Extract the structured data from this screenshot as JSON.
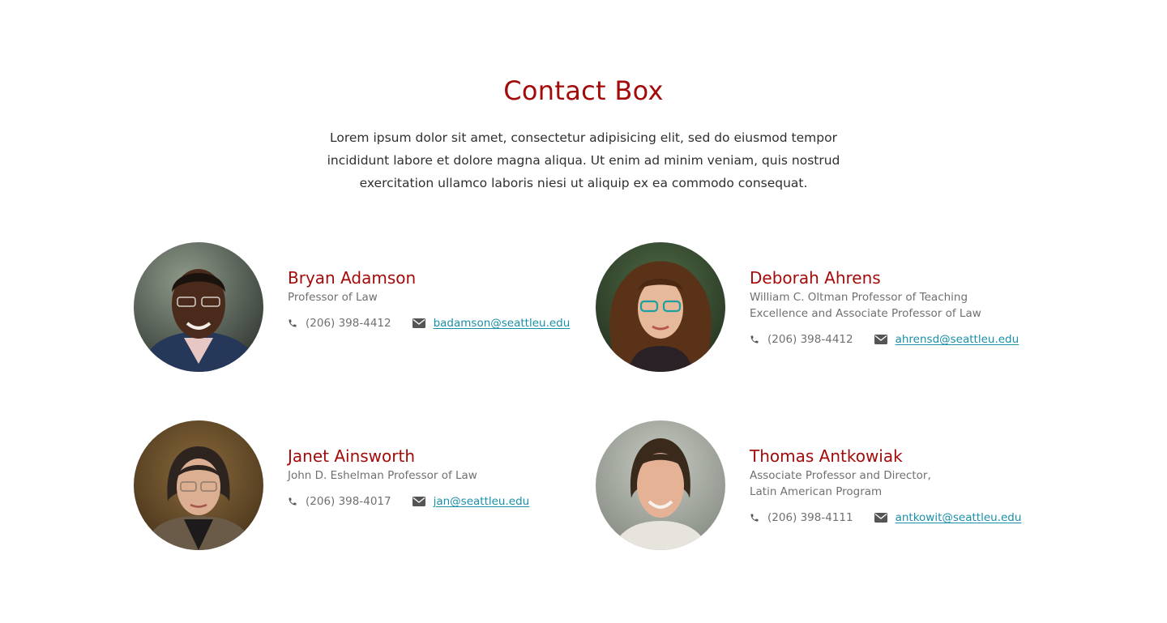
{
  "section": {
    "title": "Contact Box",
    "intro": "Lorem ipsum dolor sit amet, consectetur adipisicing elit, sed do eiusmod tempor incididunt labore et dolore magna aliqua. Ut enim ad minim veniam, quis nostrud exercitation ullamco laboris niesi ut aliquip ex ea commodo consequat."
  },
  "contacts": [
    {
      "name": "Bryan Adamson",
      "title": "Professor of Law",
      "phone": "(206) 398-4412",
      "email": "badamson@seattleu.edu",
      "icons": {
        "phone": "phone-icon",
        "email": "envelope-icon"
      }
    },
    {
      "name": "Deborah Ahrens",
      "title": "William C. Oltman Professor of Teaching Excellence and Associate Professor of Law",
      "phone": "(206) 398-4412",
      "email": "ahrensd@seattleu.edu",
      "icons": {
        "phone": "phone-icon",
        "email": "envelope-icon"
      }
    },
    {
      "name": "Janet Ainsworth",
      "title": "John D. Eshelman Professor of Law",
      "phone": "(206) 398-4017",
      "email": "jan@seattleu.edu",
      "icons": {
        "phone": "phone-icon",
        "email": "envelope-icon"
      }
    },
    {
      "name": "Thomas Antkowiak",
      "title": "Associate Professor and Director, Latin American Program",
      "phone": "(206) 398-4111",
      "email": "antkowit@seattleu.edu",
      "icons": {
        "phone": "phone-icon",
        "email": "envelope-icon"
      }
    }
  ],
  "colors": {
    "heading": "#a30b0b",
    "body_text": "#2f2f2f",
    "muted_text": "#707070",
    "link": "#1a8fa8",
    "background": "#ffffff"
  }
}
